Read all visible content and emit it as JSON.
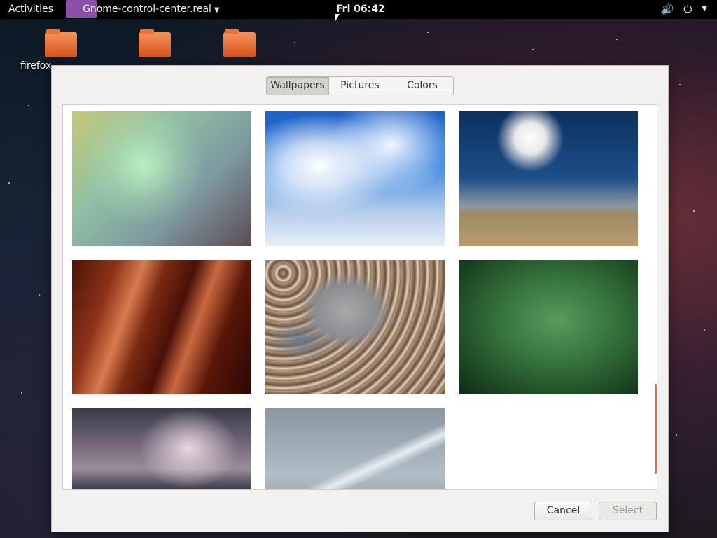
{
  "topbar": {
    "activities": "Activities",
    "app_name": "Gnome-control-center.real",
    "clock": "Fri 06:42"
  },
  "desktop": {
    "icons": [
      {
        "label": "firefox"
      },
      {
        "label": ""
      },
      {
        "label": ""
      }
    ],
    "first_label": "firefox"
  },
  "dialog": {
    "tabs": [
      {
        "label": "Wallpapers",
        "active": true
      },
      {
        "label": "Pictures",
        "active": false
      },
      {
        "label": "Colors",
        "active": false
      }
    ],
    "wallpapers": [
      "pastel-light-leak",
      "blue-sky-clouds",
      "desert-road-sky",
      "red-canyon",
      "pebbles",
      "green-vignette",
      "dusk-sea",
      "frosted-grass"
    ],
    "buttons": {
      "cancel": "Cancel",
      "select": "Select"
    },
    "accent_color": "#e06d3a"
  }
}
